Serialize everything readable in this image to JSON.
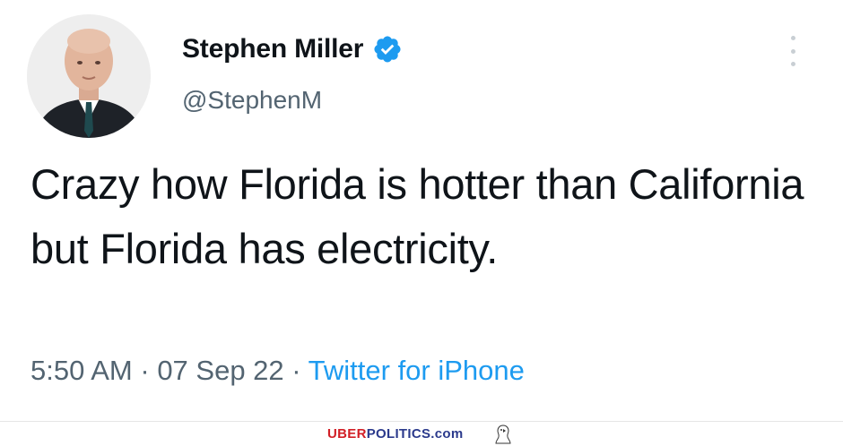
{
  "tweet": {
    "author_name": "Stephen Miller",
    "handle": "@StephenM",
    "text": "Crazy how Florida is hotter than California but Florida has electricity.",
    "time": "5:50 AM",
    "sep1": " · ",
    "date": "07 Sep 22",
    "sep2": " · ",
    "source": "Twitter for iPhone"
  },
  "icons": {
    "verified": "verified-badge-icon",
    "more": "more-vertical-icon"
  },
  "watermark": {
    "part1": "UBER",
    "part2": "POLITICS.com"
  },
  "colors": {
    "text": "#0f1419",
    "secondary": "#536471",
    "accent": "#1d9bf0",
    "watermark_red": "#d21f26",
    "watermark_blue": "#2b3a8c"
  }
}
